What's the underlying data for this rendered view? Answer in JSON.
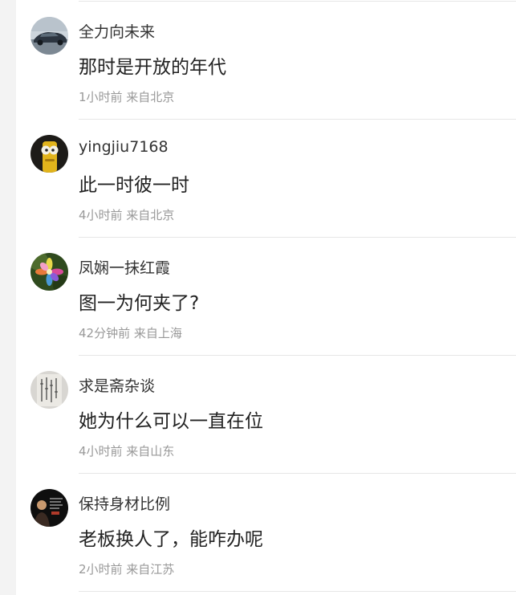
{
  "comments": [
    {
      "username": "全力向未来",
      "text": "那时是开放的年代",
      "meta": "1小时前 来自北京",
      "avatar": "car-photo-avatar"
    },
    {
      "username": "yingjiu7168",
      "text": "此一时彼一时",
      "meta": "4小时前 来自北京",
      "avatar": "yellow-cartoon-avatar"
    },
    {
      "username": "凤娴一抹红霞",
      "text": "图一为何夹了?",
      "meta": "42分钟前 来自上海",
      "avatar": "flower-avatar"
    },
    {
      "username": "求是斋杂谈",
      "text": "她为什么可以一直在位",
      "meta": "4小时前 来自山东",
      "avatar": "calligraphy-avatar"
    },
    {
      "username": "保持身材比例",
      "text": "老板换人了，能咋办呢",
      "meta": "2小时前 来自江苏",
      "avatar": "presenter-photo-avatar"
    }
  ]
}
